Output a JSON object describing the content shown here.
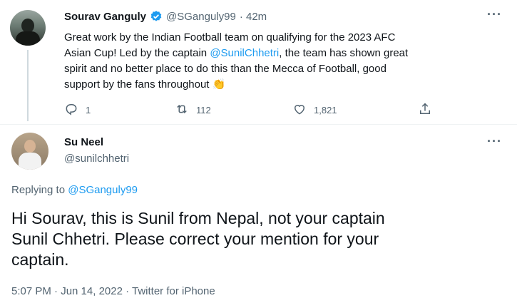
{
  "parent_tweet": {
    "author_name": "Sourav Ganguly",
    "author_handle": "@SGanguly99",
    "time": "· 42m",
    "text_1": "Great work by the Indian Football team on qualifying for the 2023 AFC",
    "text_2": "Asian Cup! Led by the captain ",
    "mention": "@SunilChhetri",
    "text_3": ", the team has shown great",
    "text_4": "spirit and no better place to do this than the Mecca of Football, good",
    "text_5": "support by the fans throughout",
    "emoji": "👏",
    "replies": "1",
    "retweets": "112",
    "likes": "1,821",
    "more": "···"
  },
  "reply_tweet": {
    "author_name": "Su Neel",
    "author_handle": "@sunilchhetri",
    "more": "···",
    "replying_prefix": "Replying to ",
    "replying_to": "@SGanguly99",
    "text_1": "Hi Sourav, this is Sunil from Nepal, not your captain",
    "text_2": "Sunil Chhetri. Please correct your mention for your",
    "text_3": "captain.",
    "meta": "5:07 PM · Jun 14, 2022 · Twitter for iPhone"
  },
  "colors": {
    "accent": "#1d9bf0",
    "muted": "#536471",
    "text": "#0f1419",
    "verified": "#1d9bf0"
  },
  "icons": [
    "verified-badge-icon",
    "reply-icon",
    "retweet-icon",
    "like-icon",
    "share-icon",
    "more-icon"
  ]
}
